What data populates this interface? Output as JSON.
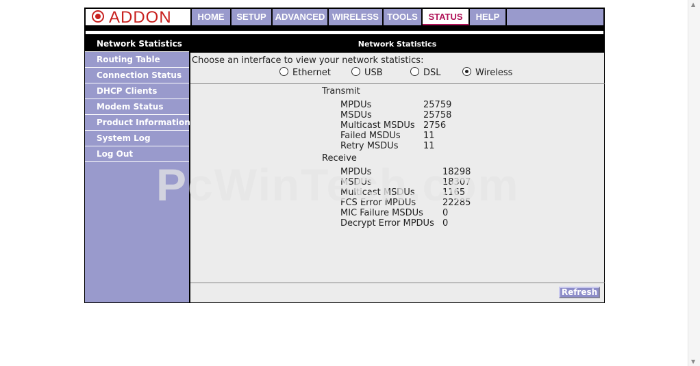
{
  "logo": {
    "text": "ADDON"
  },
  "nav": {
    "tabs": [
      {
        "label": "HOME"
      },
      {
        "label": "SETUP"
      },
      {
        "label": "ADVANCED"
      },
      {
        "label": "WIRELESS"
      },
      {
        "label": "TOOLS"
      },
      {
        "label": "STATUS"
      },
      {
        "label": "HELP"
      }
    ]
  },
  "sidebar": {
    "items": [
      {
        "label": "Network Statistics"
      },
      {
        "label": "Routing Table"
      },
      {
        "label": "Connection Status"
      },
      {
        "label": "DHCP Clients"
      },
      {
        "label": "Modem Status"
      },
      {
        "label": "Product Information"
      },
      {
        "label": "System Log"
      },
      {
        "label": "Log Out"
      }
    ]
  },
  "main": {
    "title": "Network Statistics",
    "prompt": "Choose an interface to view your network statistics:",
    "interfaces": [
      {
        "label": "Ethernet",
        "selected": false
      },
      {
        "label": "USB",
        "selected": false
      },
      {
        "label": "DSL",
        "selected": false
      },
      {
        "label": "Wireless",
        "selected": true
      }
    ],
    "transmit": {
      "title": "Transmit",
      "rows": [
        {
          "label": "MPDUs",
          "value": "25759"
        },
        {
          "label": "MSDUs",
          "value": "25758"
        },
        {
          "label": "Multicast MSDUs",
          "value": "2756"
        },
        {
          "label": "Failed MSDUs",
          "value": "11"
        },
        {
          "label": "Retry MSDUs",
          "value": "11"
        }
      ]
    },
    "receive": {
      "title": "Receive",
      "rows": [
        {
          "label": "MPDUs",
          "value": "18298"
        },
        {
          "label": "MSDUs",
          "value": "18307"
        },
        {
          "label": "Multicast MSDUs",
          "value": "1165"
        },
        {
          "label": "FCS Error MPDUs",
          "value": "22285"
        },
        {
          "label": "MIC Failure MSDUs",
          "value": "0"
        },
        {
          "label": "Decrypt Error MPDUs",
          "value": "0"
        }
      ]
    },
    "refresh_label": "Refresh"
  },
  "watermark": "PcWinTech.com",
  "colors": {
    "accent": "#999acc",
    "brand": "#c8201e",
    "active_tab": "#b01257",
    "panel": "#ececec"
  }
}
